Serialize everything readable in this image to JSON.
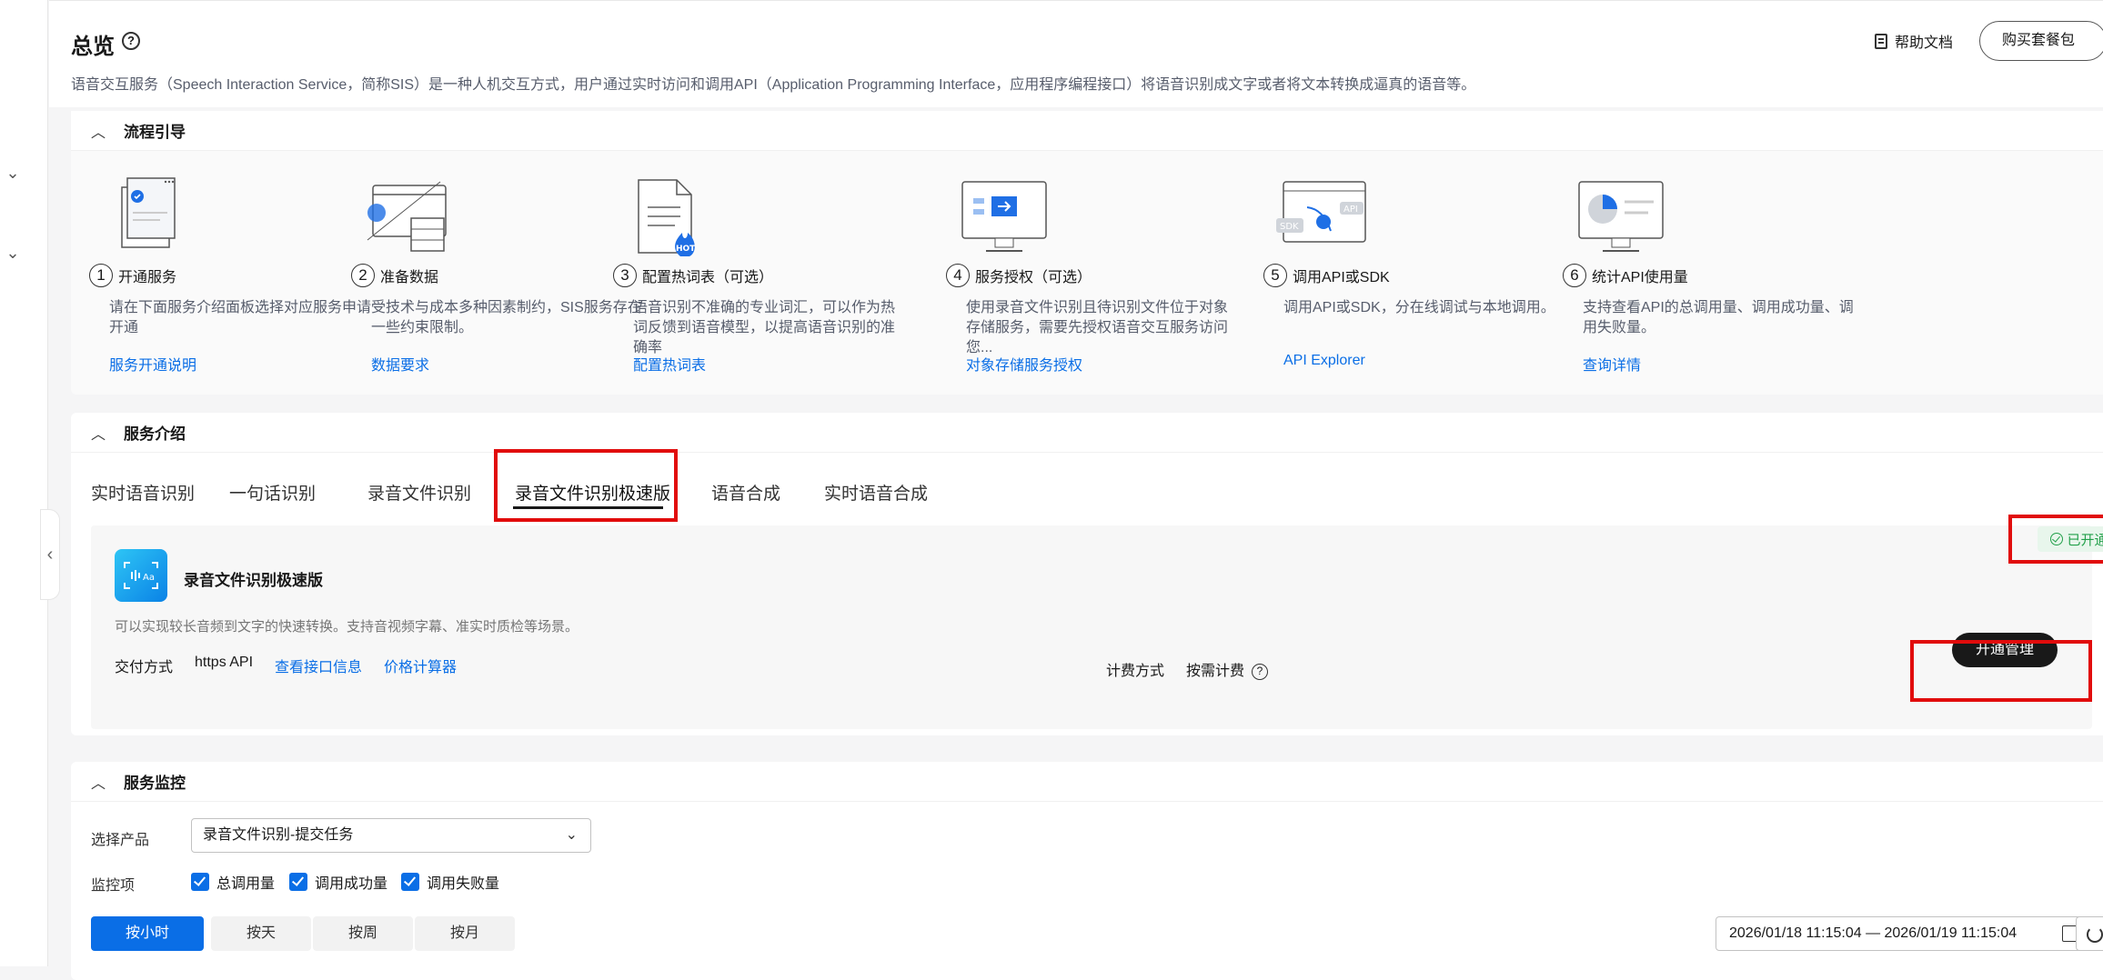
{
  "page": {
    "title": "总览",
    "help_icon": "question-circle-icon",
    "description": "语音交互服务（Speech Interaction Service，简称SIS）是一种人机交互方式，用户通过实时访问和调用API（Application Programming Interface，应用程序编程接口）将语音识别成文字或者将文本转换成逼真的语音等。",
    "help_doc_label": "帮助文档",
    "buy_button_label": "购买套餐包"
  },
  "guide": {
    "title": "流程引导",
    "steps": [
      {
        "num": "1",
        "title": "开通服务",
        "desc": "请在下面服务介绍面板选择对应服务申请开通",
        "link": "服务开通说明"
      },
      {
        "num": "2",
        "title": "准备数据",
        "desc": "受技术与成本多种因素制约，SIS服务存在一些约束限制。",
        "link": "数据要求"
      },
      {
        "num": "3",
        "title": "配置热词表（可选）",
        "desc": "语音识别不准确的专业词汇，可以作为热词反馈到语音模型，以提高语音识别的准确率",
        "link": "配置热词表"
      },
      {
        "num": "4",
        "title": "服务授权（可选）",
        "desc": "使用录音文件识别且待识别文件位于对象存储服务，需要先授权语音交互服务访问您...",
        "link": "对象存储服务授权"
      },
      {
        "num": "5",
        "title": "调用API或SDK",
        "desc": "调用API或SDK，分在线调试与本地调用。",
        "link": "API Explorer"
      },
      {
        "num": "6",
        "title": "统计API使用量",
        "desc": "支持查看API的总调用量、调用成功量、调用失败量。",
        "link": "查询详情"
      }
    ]
  },
  "intro": {
    "title": "服务介绍",
    "tabs": [
      "实时语音识别",
      "一句话识别",
      "录音文件识别",
      "录音文件识别极速版",
      "语音合成",
      "实时语音合成"
    ],
    "active_tab": "录音文件识别极速版",
    "service": {
      "name": "录音文件识别极速版",
      "description": "可以实现较长音频到文字的快速转换。支持音视频字幕、准实时质检等场景。",
      "delivery_label": "交付方式",
      "delivery_value": "https API",
      "api_info_link": "查看接口信息",
      "price_calc_link": "价格计算器",
      "billing_label": "计费方式",
      "billing_value": "按需计费",
      "status": "已开通",
      "manage_button": "开通管理"
    }
  },
  "monitor": {
    "title": "服务监控",
    "product_label": "选择产品",
    "product_value": "录音文件识别-提交任务",
    "items_label": "监控项",
    "checkboxes": [
      {
        "label": "总调用量",
        "checked": true
      },
      {
        "label": "调用成功量",
        "checked": true
      },
      {
        "label": "调用失败量",
        "checked": true
      }
    ],
    "granularity": [
      "按小时",
      "按天",
      "按周",
      "按月"
    ],
    "active_granularity": "按小时",
    "date_range": "2026/01/18 11:15:04 — 2026/01/19 11:15:04"
  },
  "colors": {
    "accent": "#0a6ee6",
    "highlight": "#e10c0c",
    "success": "#22a04a"
  }
}
